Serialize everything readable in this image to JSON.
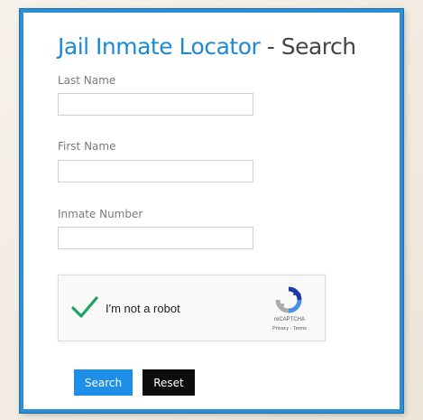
{
  "page": {
    "title_part1": "Jail Inmate Locator",
    "title_separator": " - ",
    "title_part2": "Search"
  },
  "form": {
    "last_name": {
      "label": "Last Name",
      "value": "",
      "placeholder": ""
    },
    "first_name": {
      "label": "First Name",
      "value": "",
      "placeholder": ""
    },
    "inmate_number": {
      "label": "Inmate Number",
      "value": "",
      "placeholder": ""
    }
  },
  "captcha": {
    "label": "I'm not a robot",
    "checked": true,
    "brand": "reCAPTCHA",
    "links": "Privacy - Terms",
    "check_icon": "checkmark-icon",
    "logo_icon": "recaptcha-logo-icon"
  },
  "buttons": {
    "search_label": "Search",
    "reset_label": "Reset"
  },
  "colors": {
    "accent": "#1e8ad6",
    "frame": "#2c8fd6",
    "search_button": "#1e8fe6",
    "reset_button": "#0c0c0c",
    "check": "#1aa260"
  }
}
